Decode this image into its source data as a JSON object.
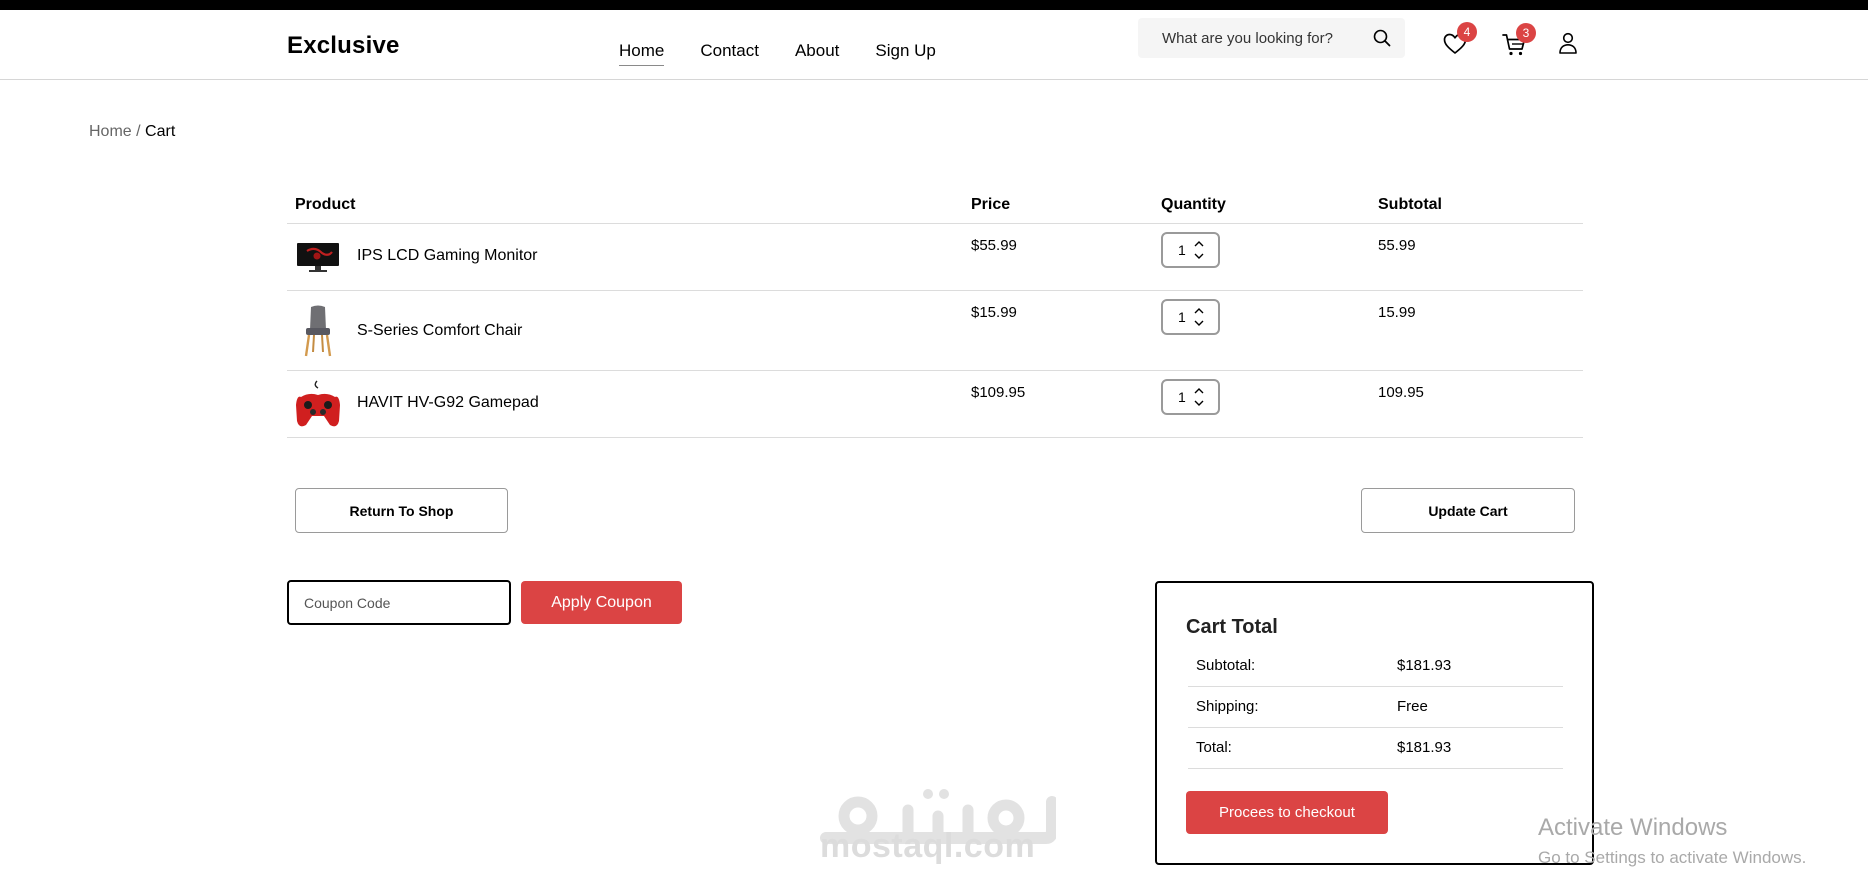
{
  "header": {
    "logo": "Exclusive",
    "nav": [
      "Home",
      "Contact",
      "About",
      "Sign Up"
    ],
    "search_placeholder": "What are you looking for?",
    "wishlist_count": "4",
    "cart_count": "3"
  },
  "breadcrumb": {
    "parent": "Home",
    "separator": "/",
    "current": "Cart"
  },
  "table": {
    "columns": [
      "Product",
      "Price",
      "Quantity",
      "Subtotal"
    ],
    "rows": [
      {
        "name": "IPS LCD Gaming Monitor",
        "price": "$55.99",
        "quantity": "1",
        "subtotal": "55.99",
        "image": "monitor"
      },
      {
        "name": "S-Series Comfort Chair",
        "price": "$15.99",
        "quantity": "1",
        "subtotal": "15.99",
        "image": "chair"
      },
      {
        "name": "HAVIT HV-G92 Gamepad",
        "price": "$109.95",
        "quantity": "1",
        "subtotal": "109.95",
        "image": "gamepad"
      }
    ]
  },
  "actions": {
    "return_label": "Return To Shop",
    "update_label": "Update Cart",
    "coupon_placeholder": "Coupon Code",
    "apply_label": "Apply Coupon"
  },
  "cart_total": {
    "title": "Cart Total",
    "subtotal_label": "Subtotal:",
    "subtotal_value": "$181.93",
    "shipping_label": "Shipping:",
    "shipping_value": "Free",
    "total_label": "Total:",
    "total_value": "$181.93",
    "checkout_label": "Procees to checkout"
  },
  "watermark": {
    "text": "mostaql.com",
    "logo_text": "مستقل"
  },
  "os_overlay": {
    "line1": "Activate Windows",
    "line2": "Go to Settings to activate Windows."
  },
  "colors": {
    "accent": "#db4444",
    "text": "#000000",
    "border": "#dcdcdc"
  }
}
